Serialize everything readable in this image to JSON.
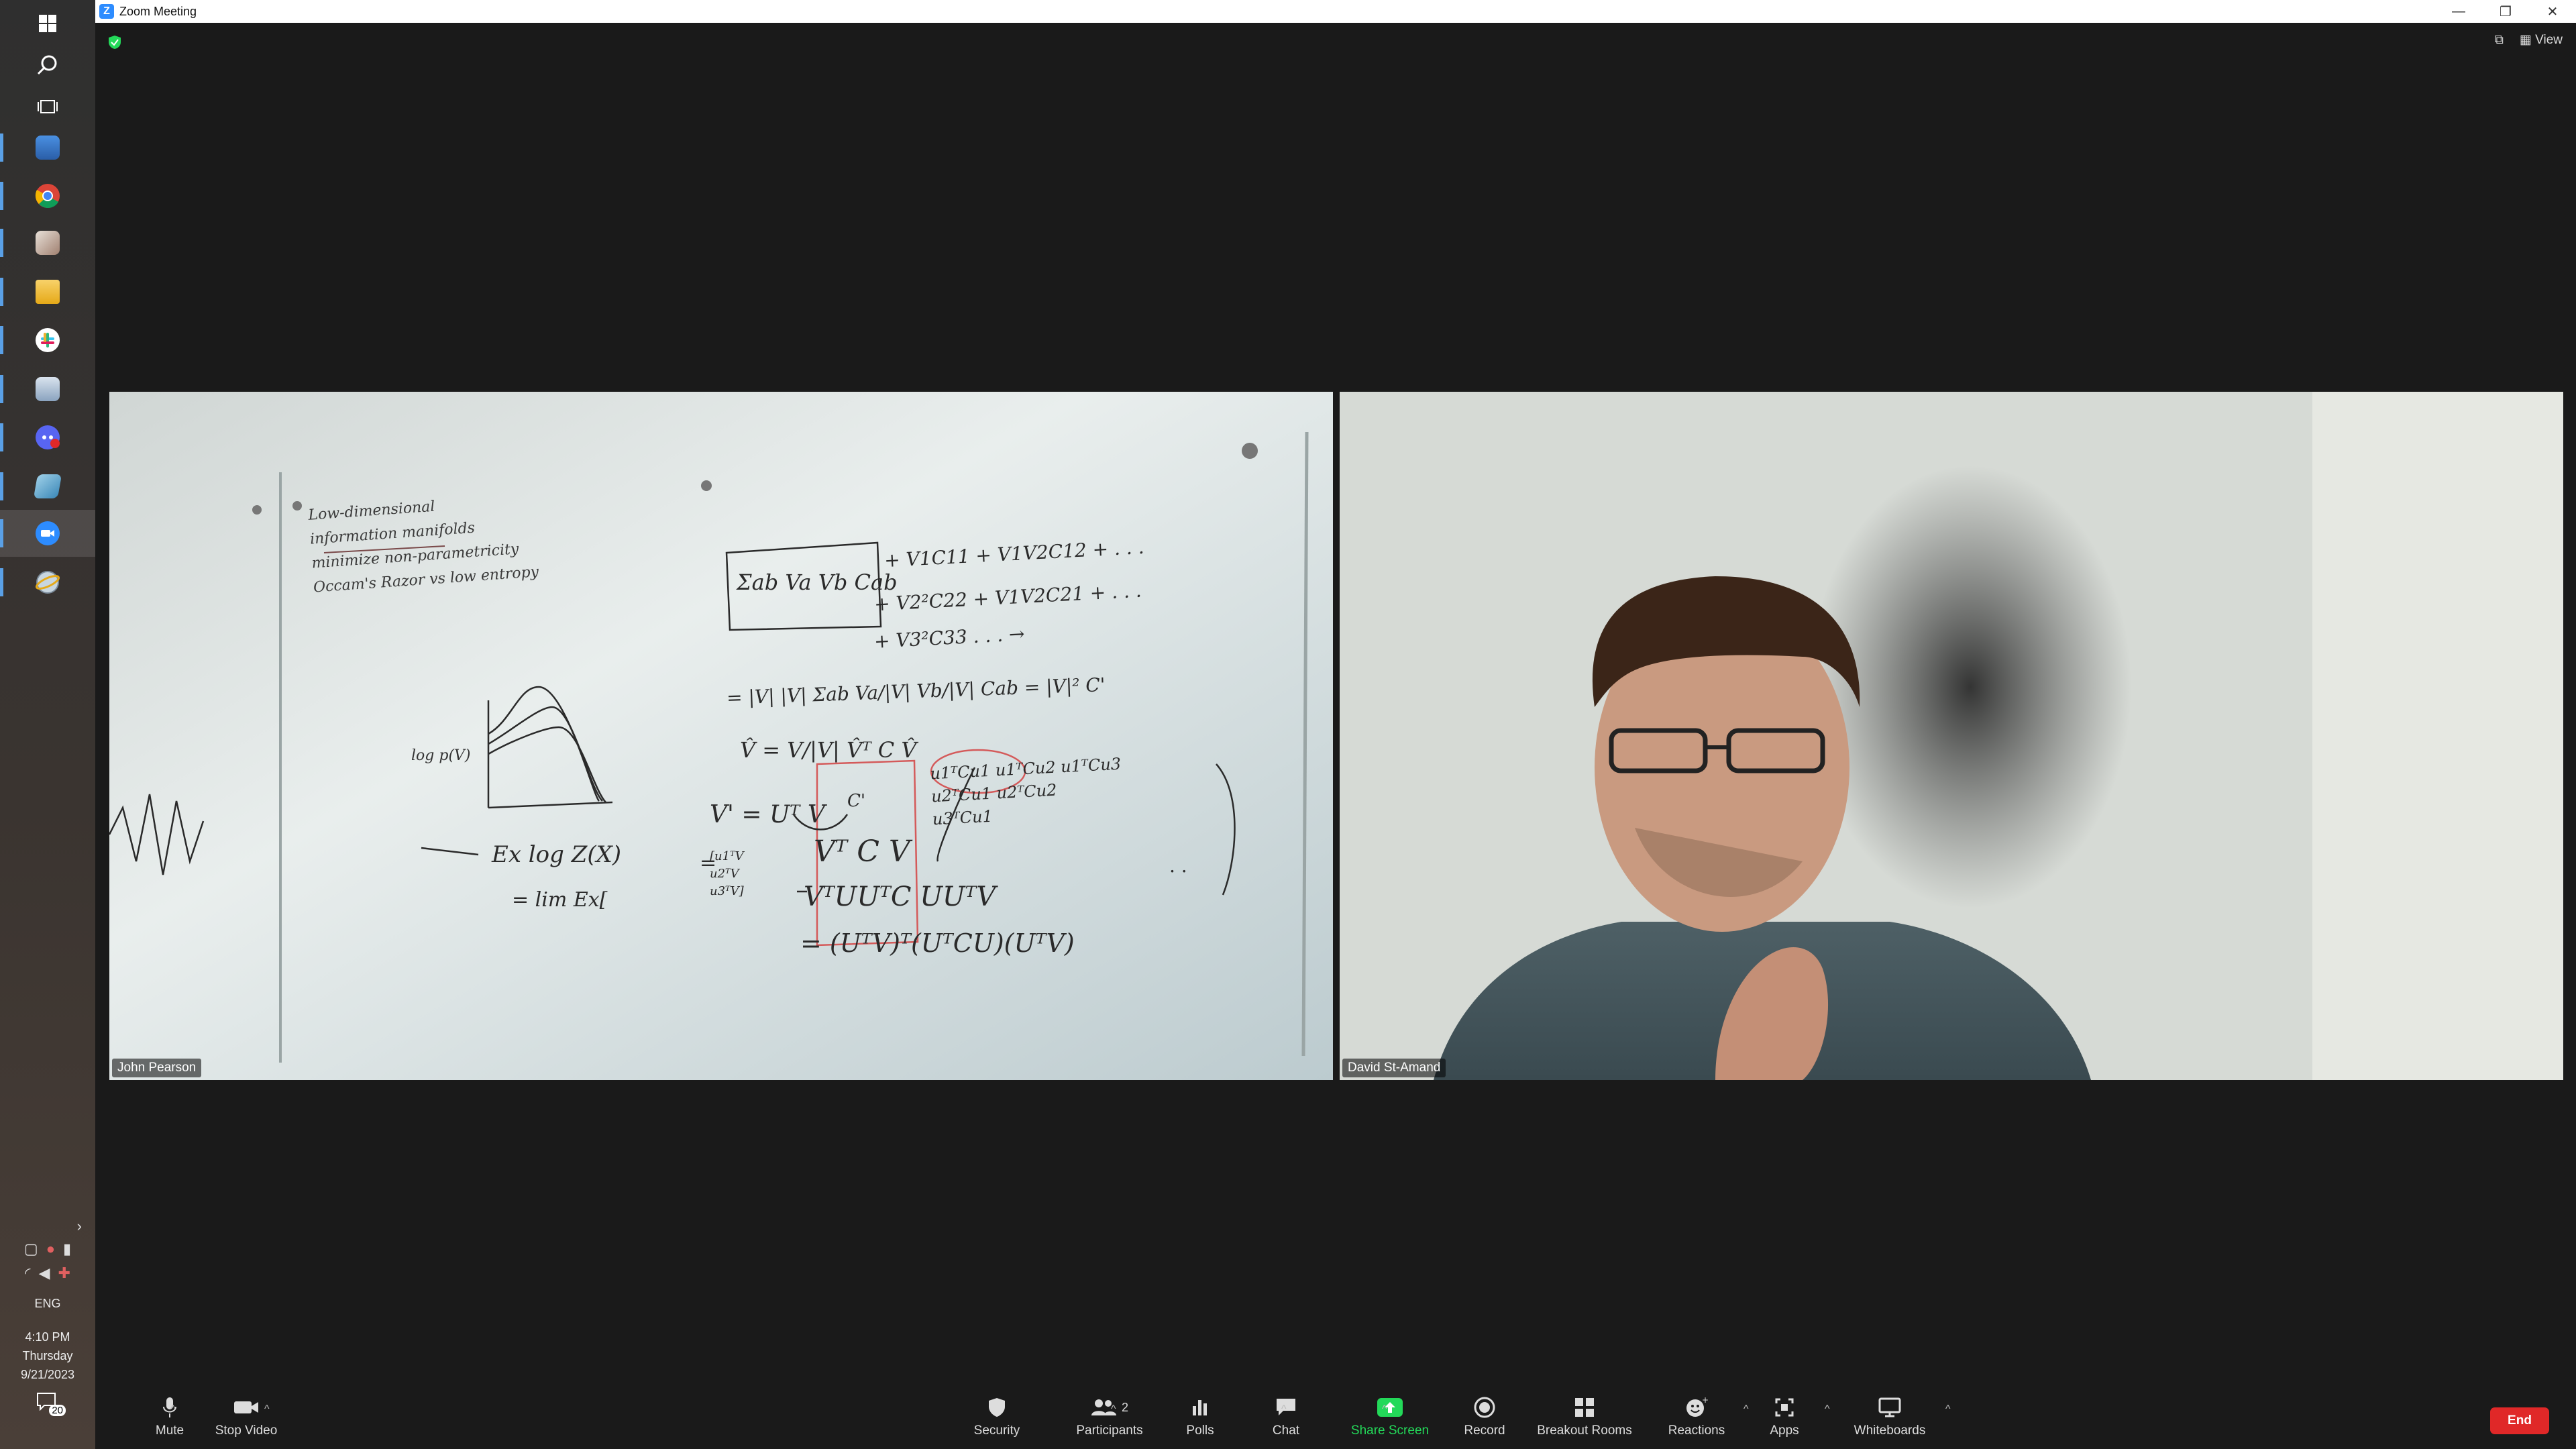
{
  "window": {
    "title": "Zoom Meeting"
  },
  "meeting": {
    "view_label": "View"
  },
  "participants": [
    {
      "name": "John Pearson"
    },
    {
      "name": "David St-Amand"
    }
  ],
  "toolbar": {
    "mute": "Mute",
    "stop_video": "Stop Video",
    "security": "Security",
    "participants": "Participants",
    "participants_count": "2",
    "polls": "Polls",
    "chat": "Chat",
    "share_screen": "Share Screen",
    "record": "Record",
    "breakout_rooms": "Breakout Rooms",
    "reactions": "Reactions",
    "apps": "Apps",
    "whiteboards": "Whiteboards",
    "end": "End"
  },
  "taskbar": {
    "language": "ENG",
    "time": "4:10 PM",
    "day": "Thursday",
    "date": "9/21/2023",
    "notifications": "20"
  },
  "whiteboard": {
    "notes": [
      "Low-dimensional",
      "information manifolds",
      "minimize non-parametricity",
      "Occam's Razor vs low entropy"
    ],
    "eq1": "Σab Va Vb Cab",
    "eq1_terms": "+ V1C11 + V1V2C12 + . . .",
    "eq1_terms2": "+ V2²C22 + V1V2C21 + . . .",
    "eq1_terms3": "+ V3²C33 . . . →",
    "eq2": "= |V| |V| Σab Va/|V| Vb/|V| Cab = |V|² C'",
    "eq3": "V̂ = V/|V|   V̂ᵀ C V̂",
    "eq3_sub": "C'",
    "eq4": "V' = Uᵀ V",
    "eq5": "Vᵀ C V",
    "eq6": "VᵀUUᵀC UUᵀV",
    "eq7": "= (UᵀV)ᵀ(UᵀCU)(UᵀV)",
    "eq8": "Ex log Z(X)",
    "eq9": "= lim Ex[",
    "matrix_r1": "u1ᵀCu1  u1ᵀCu2  u1ᵀCu3",
    "matrix_r2": "u2ᵀCu1  u2ᵀCu2",
    "matrix_r3": "u3ᵀCu1",
    "dots": ". .",
    "vec": "[u1ᵀV u2ᵀV u3ᵀV]",
    "eq_prefix": "=",
    "left_frag": "log p(V)"
  },
  "colors": {
    "accent_green": "#23d959",
    "end_red": "#e02828",
    "zoom_blue": "#2d8cff"
  }
}
